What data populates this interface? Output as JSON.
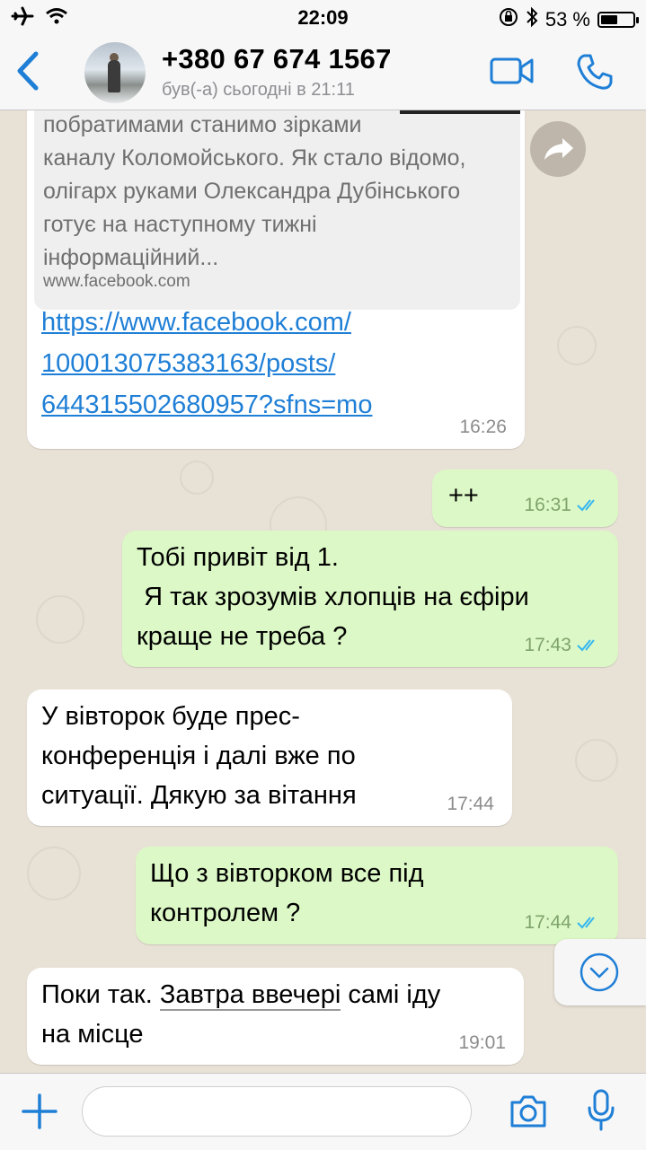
{
  "status_bar": {
    "time": "22:09",
    "battery_text": "53 %",
    "battery_level": 0.53,
    "icons": [
      "airplane-icon",
      "wifi-icon",
      "orientation-lock-icon",
      "bluetooth-icon",
      "battery-icon"
    ]
  },
  "header": {
    "contact_name": "+380 67 674 1567",
    "last_seen": "був(-а) сьогодні в 21:11",
    "accent_color": "#1f7fd6"
  },
  "messages": [
    {
      "direction": "incoming",
      "preview_text": "побратимами станимо зірками\nканалу Коломойського. Як стало відомо,\nолігарх руками Олександра Дубінського\nготує на наступному тижні\nінформаційний...",
      "preview_domain": "www.facebook.com",
      "link": "https://www.facebook.com/\n100013075383163/posts/\n644315502680957?sfns=mo",
      "time": "16:26"
    },
    {
      "direction": "outgoing",
      "text": "++",
      "time": "16:31",
      "status": "read"
    },
    {
      "direction": "outgoing",
      "text": "Тобі привіт від 1.\n Я так зрозумів хлопців на єфіри\nкраще не треба ?",
      "time": "17:43",
      "status": "read"
    },
    {
      "direction": "incoming",
      "text": "У вівторок буде прес-\nконференція і далі вже по\nситуації. Дякую за вітання",
      "time": "17:44"
    },
    {
      "direction": "outgoing",
      "text": "Що з вівторком все під\nконтролем ?",
      "time": "17:44",
      "status": "read"
    },
    {
      "direction": "incoming",
      "text_before": "Поки так. ",
      "text_underlined": "Завтра ввечері",
      "text_after": " самі іду\nна місце",
      "time": "19:01"
    }
  ],
  "input": {
    "placeholder": ""
  }
}
